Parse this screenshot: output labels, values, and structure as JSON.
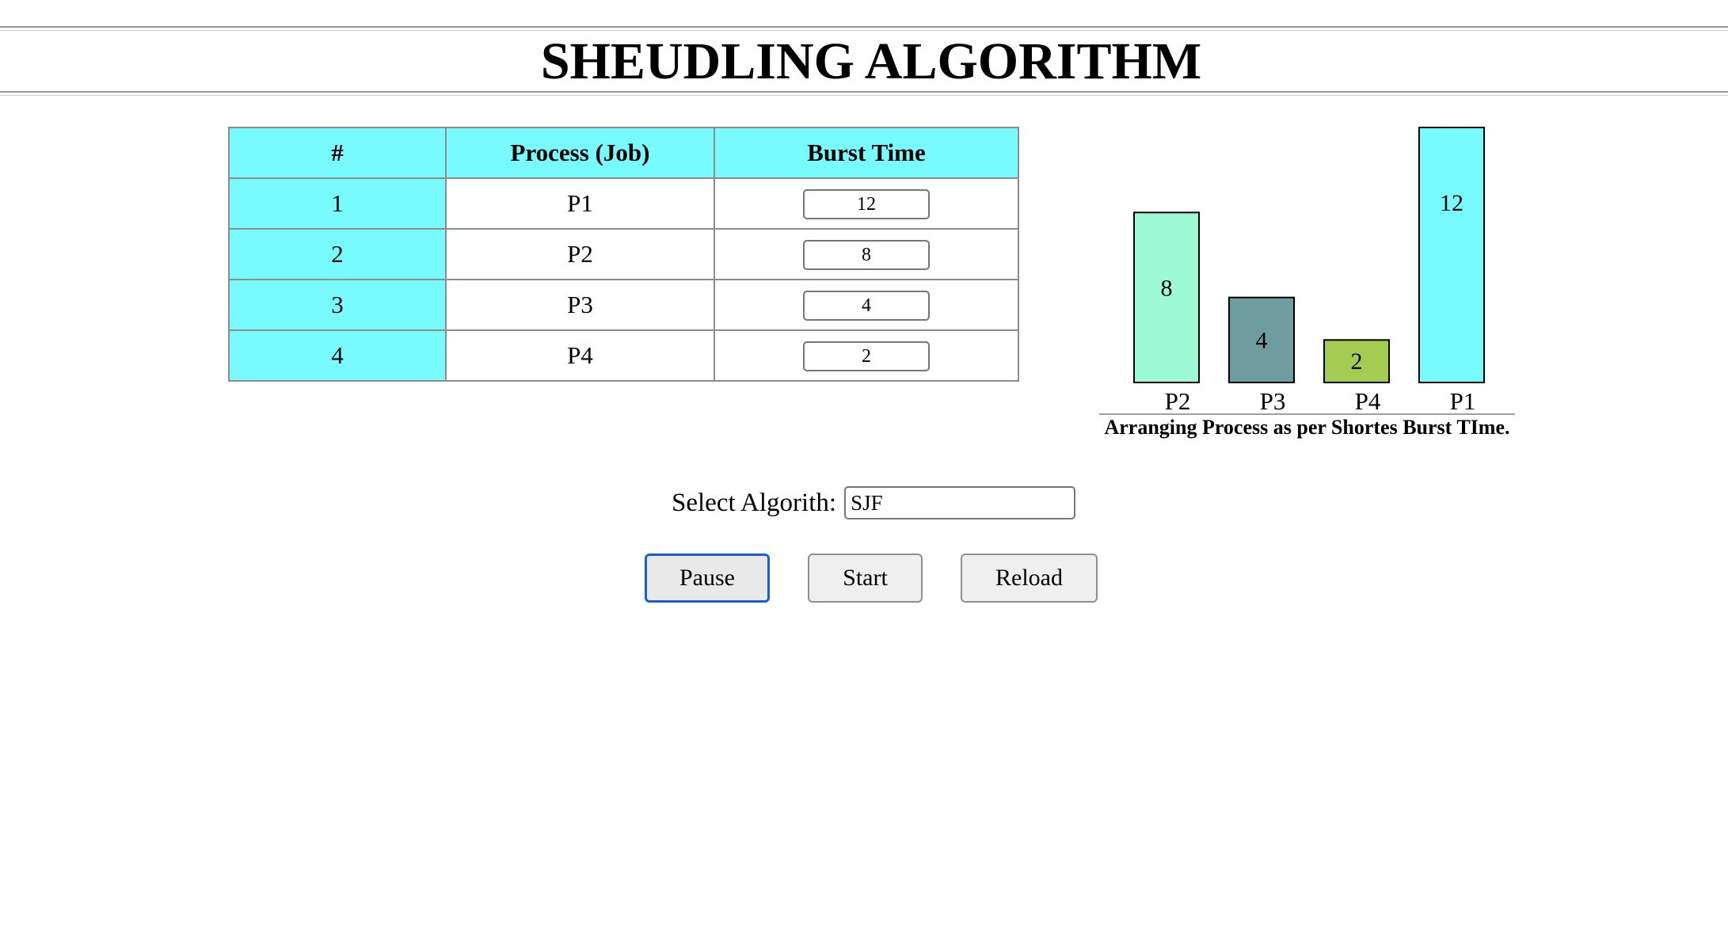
{
  "header": {
    "title": "SHEUDLING ALGORITHM"
  },
  "table": {
    "columns": [
      "#",
      "Process (Job)",
      "Burst Time"
    ],
    "rows": [
      {
        "index": "1",
        "process": "P1",
        "burst": "12"
      },
      {
        "index": "2",
        "process": "P2",
        "burst": "8"
      },
      {
        "index": "3",
        "process": "P3",
        "burst": "4"
      },
      {
        "index": "4",
        "process": "P4",
        "burst": "2"
      }
    ]
  },
  "chart_data": {
    "type": "bar",
    "categories": [
      "P2",
      "P3",
      "P4",
      "P1"
    ],
    "values": [
      8,
      4,
      2,
      12
    ],
    "colors": [
      "#9dfad7",
      "#6f9c9e",
      "#a2cc52",
      "#78fbff"
    ],
    "xlabel": "Arranging Process as per Shortes Burst TIme."
  },
  "controls": {
    "algorithm_label": "Select Algorith:",
    "algorithm_value": "SJF",
    "pause_label": "Pause",
    "start_label": "Start",
    "reload_label": "Reload"
  }
}
